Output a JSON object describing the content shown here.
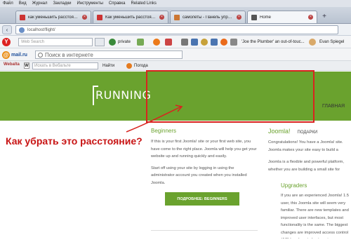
{
  "menubar": {
    "items": [
      "Файл",
      "Вид",
      "Журнал",
      "Закладки",
      "Инструменты",
      "Справка",
      "Related Links"
    ]
  },
  "tabs": [
    {
      "label": "как уменьшить расстояние ...",
      "fav_color": "#c33"
    },
    {
      "label": "Как уменьшить расстояние ...",
      "fav_color": "#c33"
    },
    {
      "label": "самолеты - Панель управле...",
      "fav_color": "#c73"
    },
    {
      "label": "Home",
      "fav_color": "#555",
      "active": true
    }
  ],
  "address": {
    "url": "localhost/flight/"
  },
  "toolbar1": {
    "search_placeholder": "Web Search",
    "private_label": "private",
    "bookmark_label": "'Joe the Plumber' an out-of-touc...",
    "user_label": "Evan Spiegel"
  },
  "toolbar2": {
    "brand": "mail.ru",
    "search_placeholder": "Поиск в интернете"
  },
  "toolbar3": {
    "brand": "Webalta",
    "w_label": "W",
    "search_placeholder": "Искать в Вебальте",
    "find_label": "Найти",
    "weather_label": "Погода"
  },
  "site": {
    "logo_text": "RUNNING",
    "nav_home": "ГЛАВНАЯ",
    "col_mid": {
      "heading": "Beginners",
      "para1": "If this is your first Joomla! site or your first web site, you have come to the right place. Joomla will help you get your website up and running quickly and easily.",
      "para2": "Start off using your site by logging in using the administrator account you created when you installed Joomla.",
      "button": "ПОДРОБНЕЕ: BEGINNERS"
    },
    "col_right": {
      "heading": "Joomla!",
      "gifts": "ПОДАРКИ",
      "para1": "Congratulations! You have a Joomla! site. Joomla makes your site easy to build a website just the way you want it and keep it simple to update and maintain.",
      "para2": "Joomla is a flexible and powerful platform, whether you are building a small site for yourself or a huge site with hundreds of thousands of visitors. Joomla is open source, which means you can make it work just the way you want it to.",
      "upgraders_heading": "Upgraders",
      "upgraders_para": "If you are an experienced Joomla! 1.5 user, this Joomla site will seem very familiar. There are new templates and improved user interfaces, but most functionality is the same. The biggest changes are improved access control (ACL) and nested categories."
    }
  },
  "annotation": {
    "question": "Как убрать это расстояние?",
    "color": "#d9231f"
  }
}
